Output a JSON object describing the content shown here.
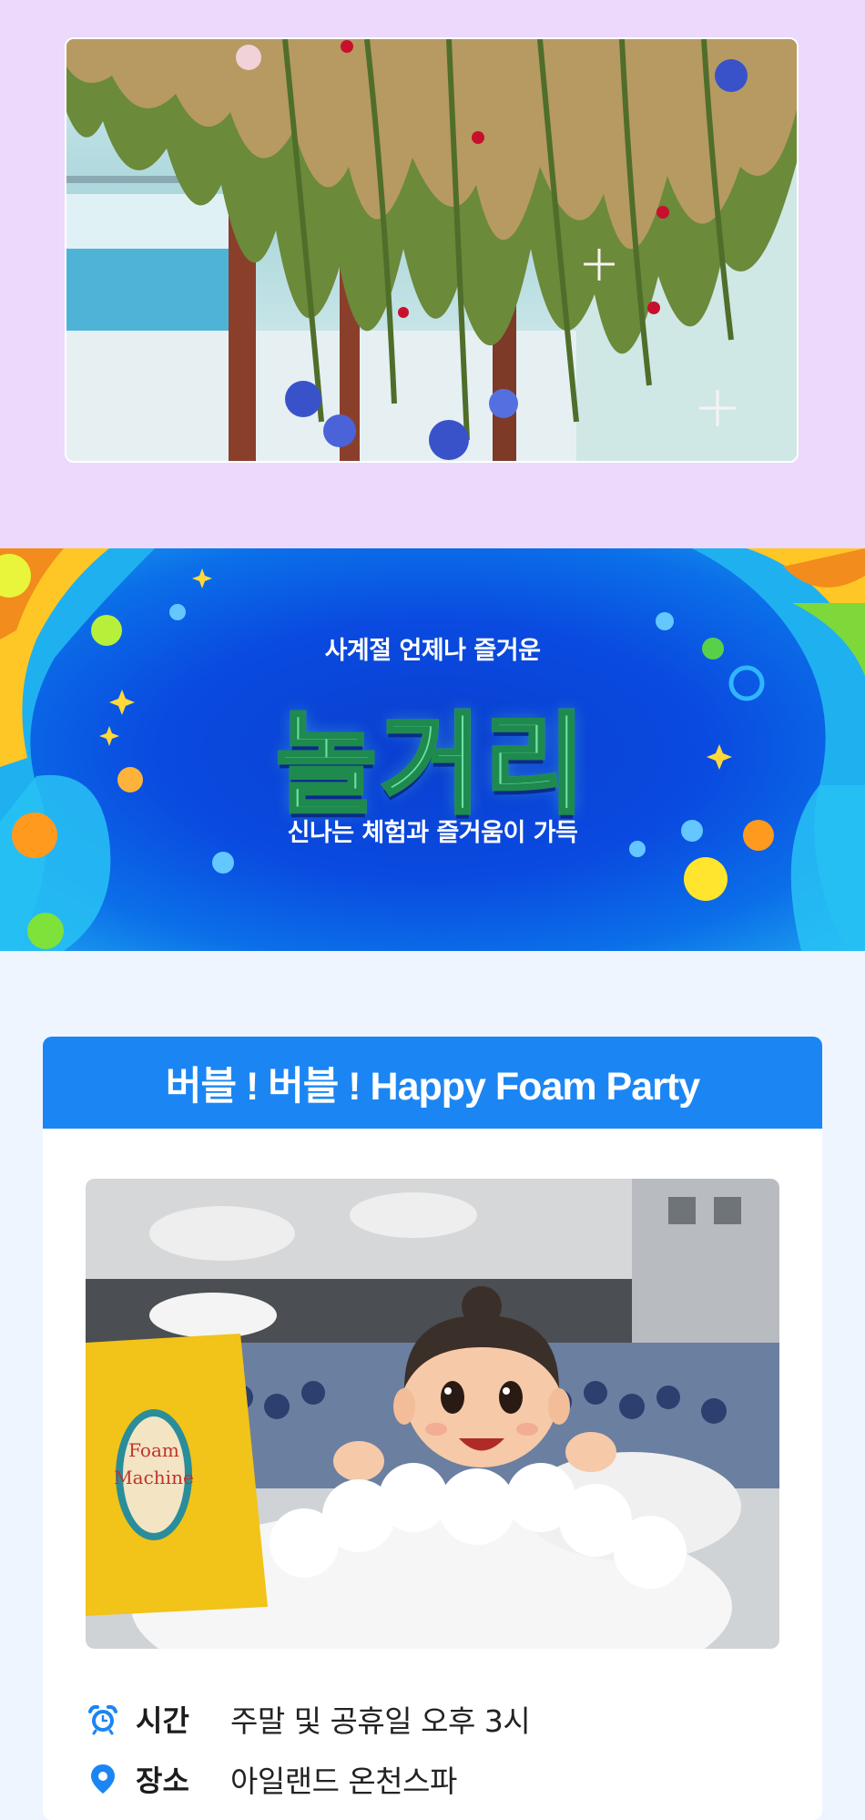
{
  "banner": {
    "kicker": "사계절 언제나 즐거운",
    "title": "놀거리",
    "subtitle": "신나는 체험과 즐거움이 가득"
  },
  "event": {
    "title": "버블 ! 버블 ! Happy Foam Party",
    "photo_sign": [
      "Foam",
      "Machine"
    ],
    "info": [
      {
        "icon": "alarm-clock-icon",
        "label": "시간",
        "value": "주말 및 공휴일 오후 3시"
      },
      {
        "icon": "location-pin-icon",
        "label": "장소",
        "value": "아일랜드 온천스파"
      }
    ]
  },
  "colors": {
    "garden_bg": "#ecd9fb",
    "banner_blue": "#0a4ae0",
    "header_blue": "#1b86f3",
    "page_bg": "#eef5ff",
    "title_green": "#6ee0a4"
  }
}
